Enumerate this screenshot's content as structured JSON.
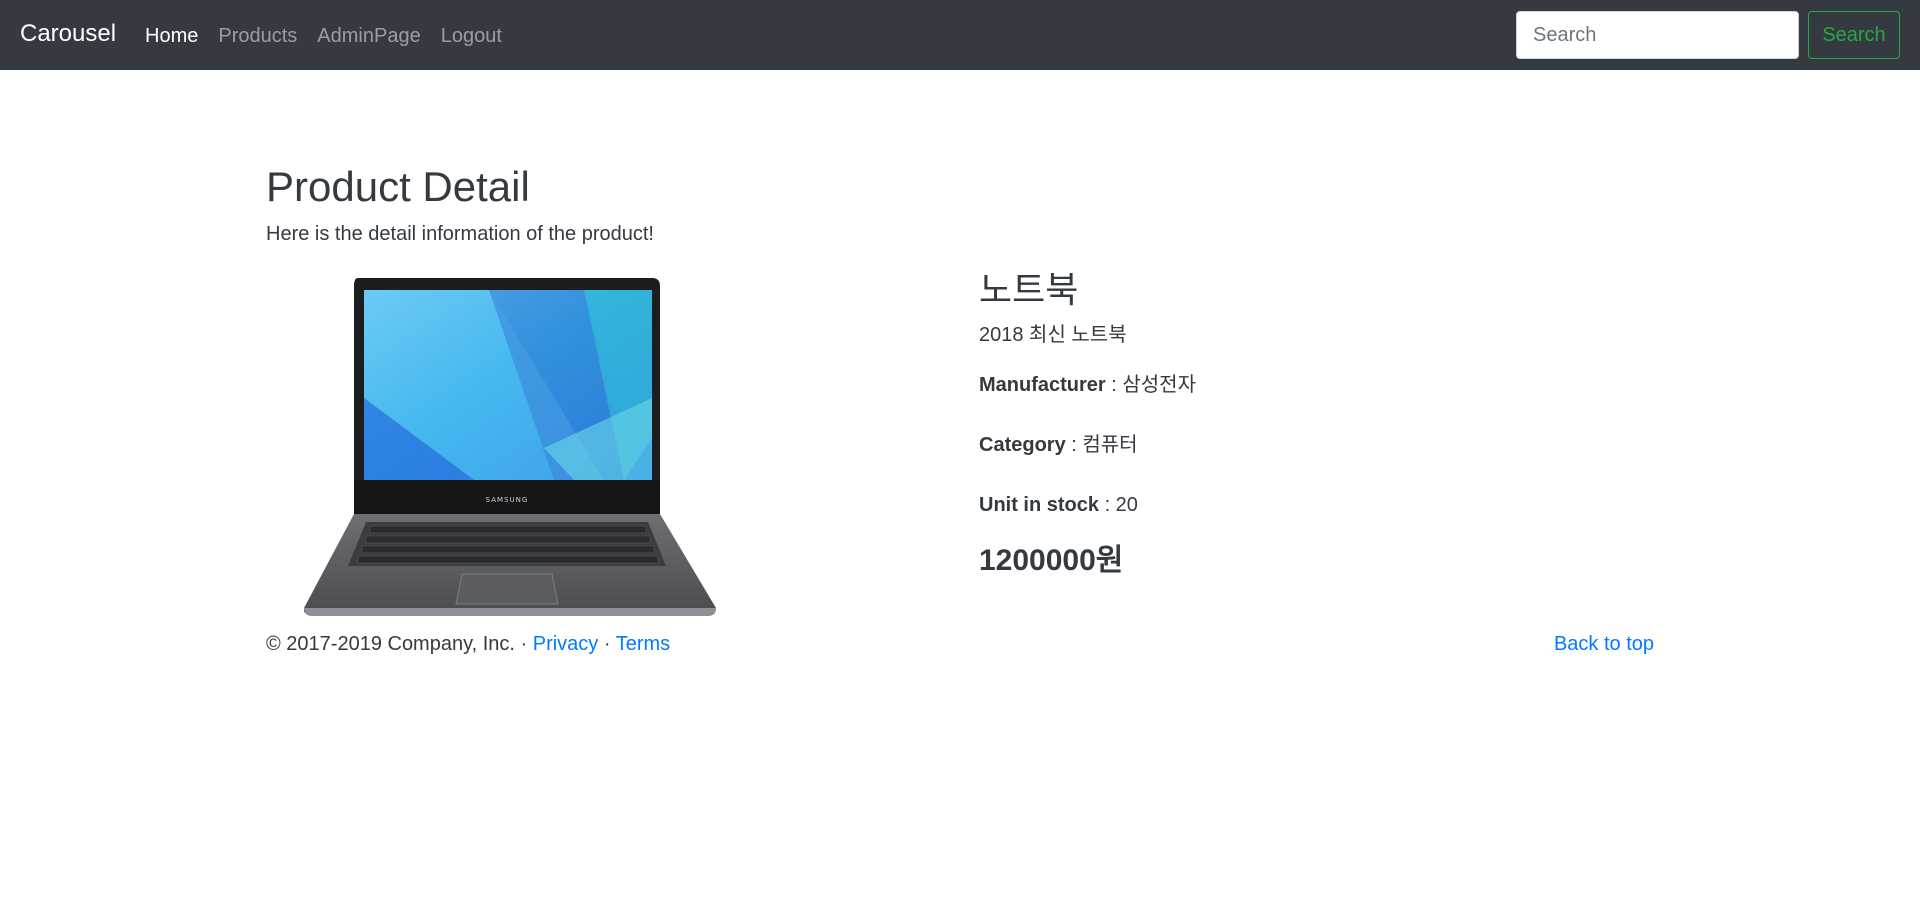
{
  "navbar": {
    "brand": "Carousel",
    "items": [
      {
        "label": "Home",
        "active": true
      },
      {
        "label": "Products",
        "active": false
      },
      {
        "label": "AdminPage",
        "active": false
      },
      {
        "label": "Logout",
        "active": false
      }
    ],
    "search_placeholder": "Search",
    "search_button": "Search"
  },
  "main": {
    "title": "Product Detail",
    "lead": "Here is the detail information of the product!"
  },
  "product": {
    "name": "노트북",
    "description": "2018 최신 노트북",
    "manufacturer_label": "Manufacturer",
    "manufacturer_value": " : 삼성전자",
    "category_label": "Category",
    "category_value": " : 컴퓨터",
    "stock_label": "Unit in stock",
    "stock_value": " : 20",
    "price": "1200000원",
    "image_brand_text": "SAMSUNG"
  },
  "footer": {
    "copyright": "© 2017-2019 Company, Inc. · ",
    "privacy": "Privacy",
    "separator": " · ",
    "terms": "Terms",
    "back_to_top": "Back to top"
  },
  "colors": {
    "navbar_bg": "#343a40",
    "link": "#007bff",
    "success": "#28a745",
    "text": "#343a40"
  }
}
